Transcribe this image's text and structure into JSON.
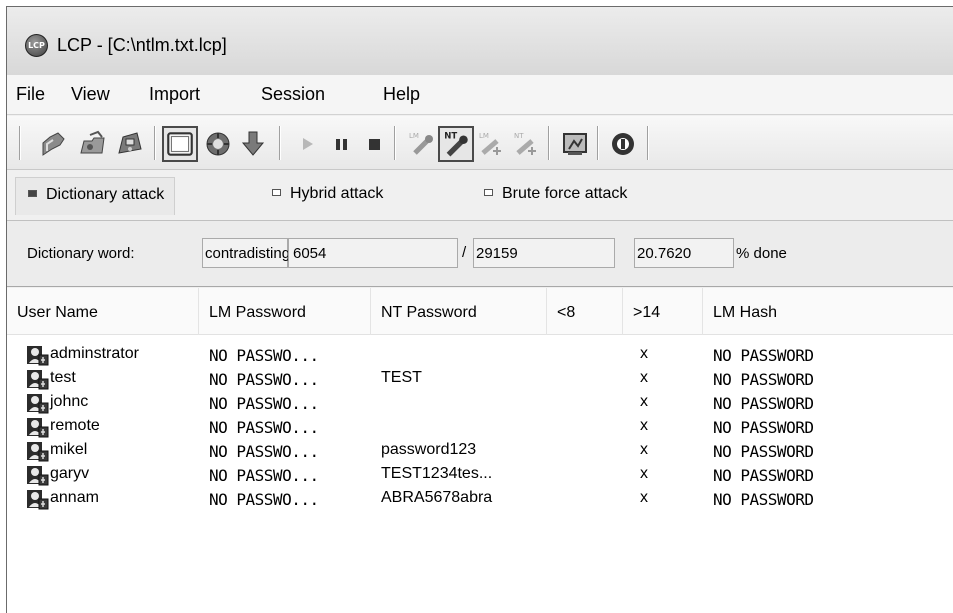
{
  "window": {
    "title": "LCP - [C:\\ntlm.txt.lcp]",
    "app_icon_text": "LCP"
  },
  "menu": [
    "File",
    "View",
    "Import",
    "Session",
    "Help"
  ],
  "toolbar": {
    "buttons": [
      "new-session-icon",
      "open-session-icon",
      "save-session-icon",
      "select-source-icon",
      "options-icon",
      "import-icon",
      "start-icon",
      "pause-icon",
      "stop-icon",
      "lm-attack-icon",
      "nt-attack-icon",
      "lm-brute-icon",
      "nt-brute-icon",
      "report-icon",
      "about-icon"
    ],
    "nt_label": "NT",
    "lm_label": "LM"
  },
  "attack_tabs": [
    {
      "label": "Dictionary attack",
      "active": true
    },
    {
      "label": "Hybrid attack",
      "active": false
    },
    {
      "label": "Brute force attack",
      "active": false
    }
  ],
  "progress": {
    "label": "Dictionary word:",
    "word": "contradisting",
    "current": "6054",
    "slash": "/",
    "total": "29159",
    "percent": "20.7620",
    "percent_suffix": "% done"
  },
  "table": {
    "columns": [
      "User Name",
      "LM Password",
      "NT Password",
      "<8",
      ">14",
      "LM Hash"
    ],
    "rows": [
      {
        "user": "adminstrator",
        "lm": "NO PASSWO...",
        "nt": "",
        "lt8": "",
        "gt14": "x",
        "lmhash": "NO PASSWORD"
      },
      {
        "user": "test",
        "lm": "NO PASSWO...",
        "nt": "TEST",
        "lt8": "",
        "gt14": "x",
        "lmhash": "NO PASSWORD"
      },
      {
        "user": "johnc",
        "lm": "NO PASSWO...",
        "nt": "",
        "lt8": "",
        "gt14": "x",
        "lmhash": "NO PASSWORD"
      },
      {
        "user": "remote",
        "lm": "NO PASSWO...",
        "nt": "",
        "lt8": "",
        "gt14": "x",
        "lmhash": "NO PASSWORD"
      },
      {
        "user": "mikel",
        "lm": "NO PASSWO...",
        "nt": "password123",
        "lt8": "",
        "gt14": "x",
        "lmhash": "NO PASSWORD"
      },
      {
        "user": "garyv",
        "lm": "NO PASSWO...",
        "nt": "TEST1234tes...",
        "lt8": "",
        "gt14": "x",
        "lmhash": "NO PASSWORD"
      },
      {
        "user": "annam",
        "lm": "NO PASSWO...",
        "nt": "ABRA5678abra",
        "lt8": "",
        "gt14": "x",
        "lmhash": "NO PASSWORD"
      }
    ]
  }
}
